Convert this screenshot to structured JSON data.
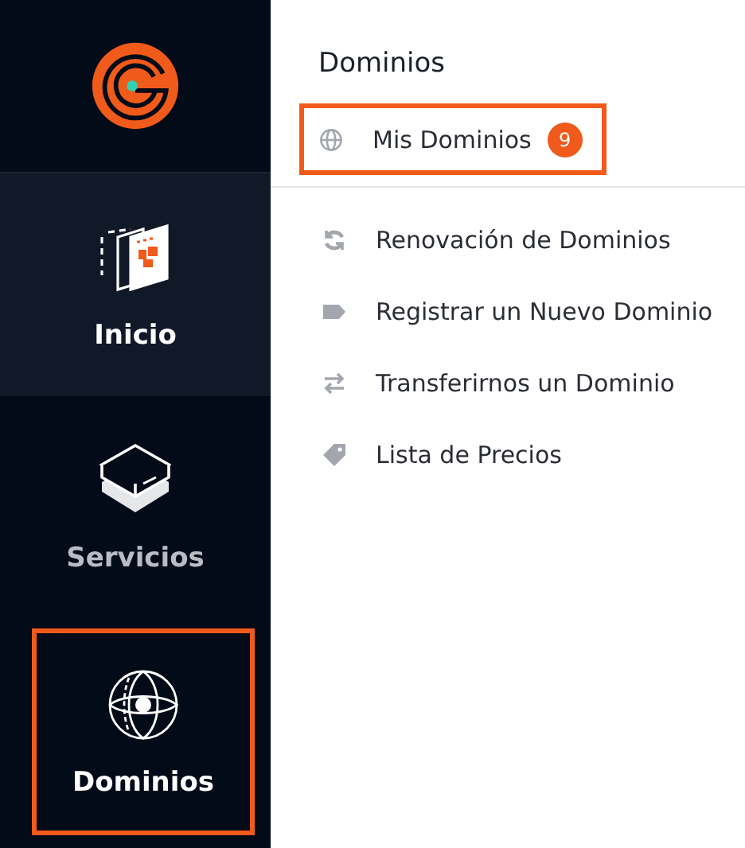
{
  "sidebar": {
    "items": [
      {
        "label": "Inicio",
        "kind": "home",
        "selected": true,
        "highlighted": false
      },
      {
        "label": "Servicios",
        "kind": "services",
        "selected": false,
        "highlighted": false
      },
      {
        "label": "Dominios",
        "kind": "domains",
        "selected": false,
        "highlighted": true
      }
    ]
  },
  "panel": {
    "title": "Dominios",
    "primary": [
      {
        "label": "Mis Dominios",
        "kind": "globe",
        "badge": "9",
        "highlighted": true
      }
    ],
    "items": [
      {
        "label": "Renovación de Dominios",
        "kind": "renew",
        "highlighted": false
      },
      {
        "label": "Registrar un Nuevo Dominio",
        "kind": "label",
        "highlighted": false
      },
      {
        "label": "Transferirnos un Dominio",
        "kind": "transfer",
        "highlighted": false
      },
      {
        "label": "Lista de Precios",
        "kind": "tag",
        "highlighted": false
      }
    ]
  }
}
